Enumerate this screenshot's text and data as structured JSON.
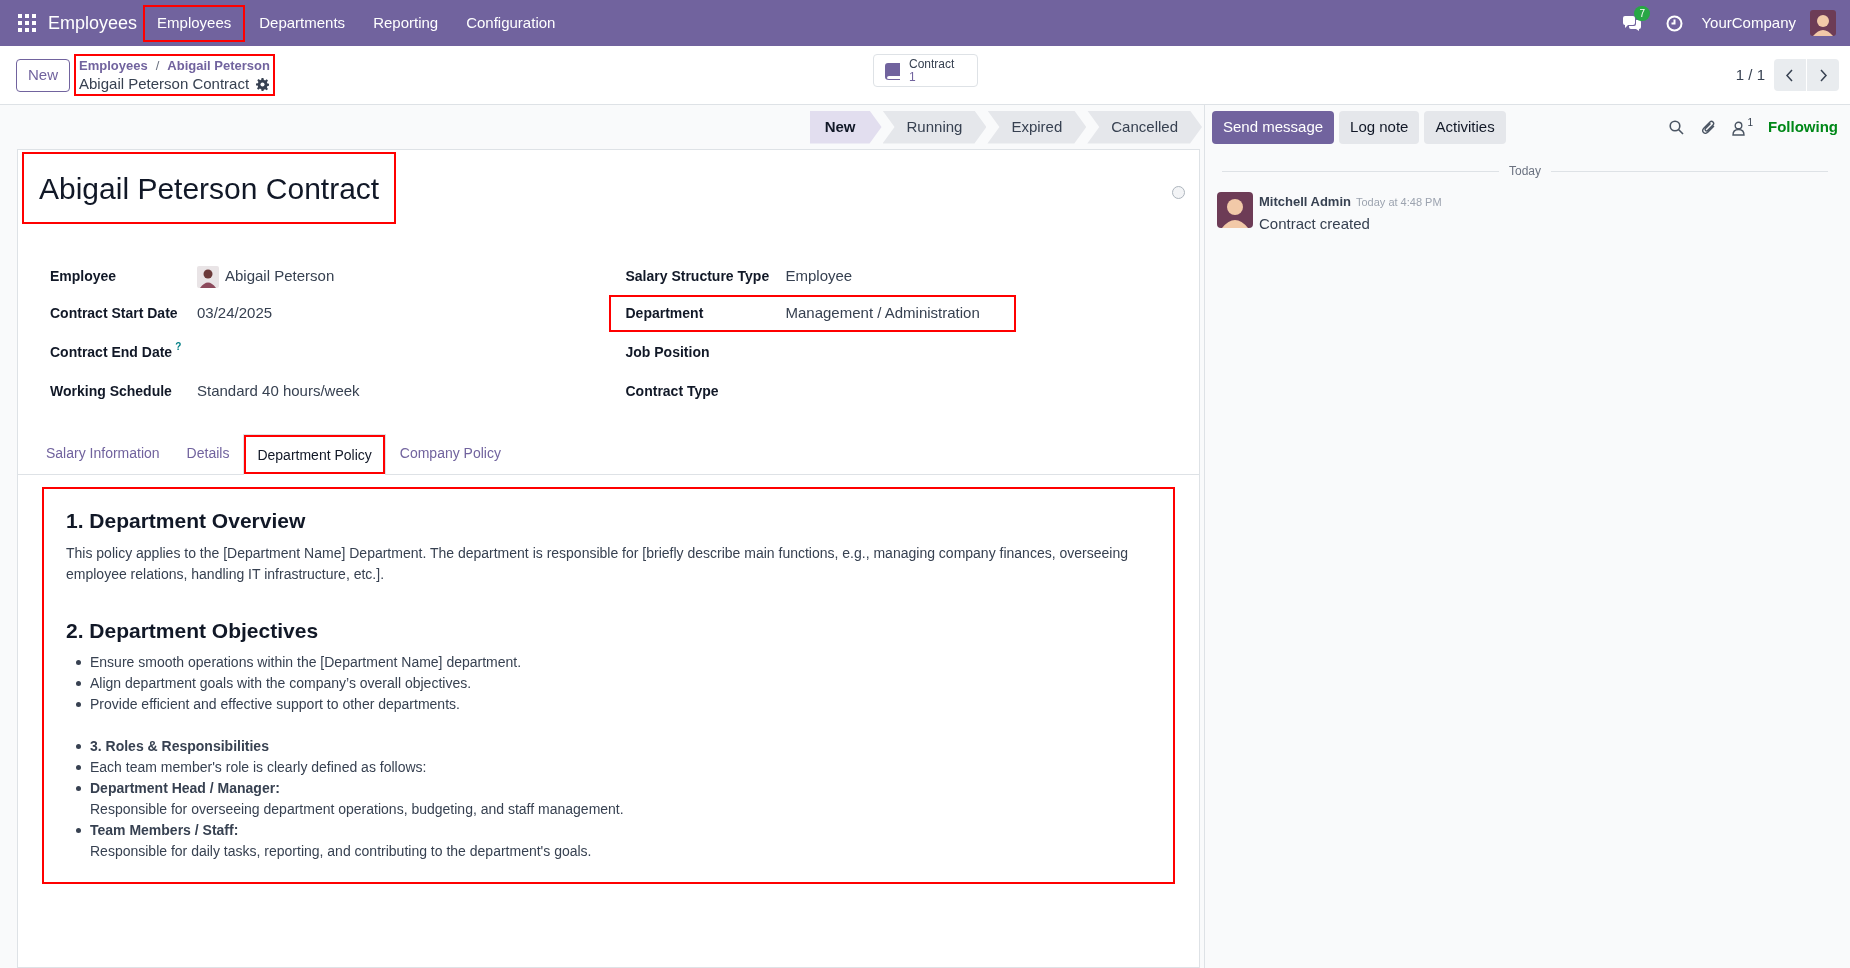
{
  "navbar": {
    "app_name": "Employees",
    "menu": [
      {
        "label": "Employees",
        "highlighted": true
      },
      {
        "label": "Departments",
        "highlighted": false
      },
      {
        "label": "Reporting",
        "highlighted": false
      },
      {
        "label": "Configuration",
        "highlighted": false
      }
    ],
    "messages_badge": "7",
    "company": "YourCompany"
  },
  "control_panel": {
    "new_button": "New",
    "breadcrumbs": [
      "Employees",
      "Abigail Peterson"
    ],
    "breadcrumb_separator": "/",
    "record_title": "Abigail Peterson Contract",
    "highlighted": true,
    "smart_button": {
      "label": "Contract",
      "count": "1"
    },
    "pager": "1 / 1"
  },
  "status_steps": [
    {
      "label": "New",
      "selected": true
    },
    {
      "label": "Running",
      "selected": false
    },
    {
      "label": "Expired",
      "selected": false
    },
    {
      "label": "Cancelled",
      "selected": false
    }
  ],
  "form": {
    "title": "Abigail Peterson Contract",
    "title_highlighted": true,
    "left_fields": [
      {
        "label": "Employee",
        "value": "Abigail Peterson",
        "kind": "avatar",
        "highlighted": false
      },
      {
        "label": "Contract Start Date",
        "value": "03/24/2025",
        "kind": "text",
        "highlighted": false
      },
      {
        "label": "Contract End Date",
        "help": "?",
        "highlighted": false
      },
      {
        "label": "Working Schedule",
        "value": "Standard 40 hours/week",
        "kind": "text",
        "highlighted": false
      }
    ],
    "right_fields": [
      {
        "label": "Salary Structure Type",
        "value": "Employee",
        "kind": "text",
        "highlighted": false
      },
      {
        "label": "Department",
        "value": "Management / Administration",
        "kind": "text",
        "highlighted": true
      },
      {
        "label": "Job Position",
        "highlighted": false
      },
      {
        "label": "Contract Type",
        "highlighted": false
      }
    ],
    "tabs": [
      {
        "label": "Salary Information",
        "selected": false,
        "highlighted": false
      },
      {
        "label": "Details",
        "selected": false,
        "highlighted": false
      },
      {
        "label": "Department Policy",
        "selected": true,
        "highlighted": true
      },
      {
        "label": "Company Policy",
        "selected": false,
        "highlighted": false
      }
    ],
    "policy": {
      "highlighted": true,
      "sections": [
        {
          "heading": "1. Department Overview",
          "paragraph": "This policy applies to the [Department Name] Department. The department is responsible for [briefly describe main functions, e.g., managing company finances, overseeing employee relations, handling IT infrastructure, etc.]."
        },
        {
          "heading": "2. Department Objectives",
          "lists": [
            [
              {
                "kind": "text",
                "text": "Ensure smooth operations within the [Department Name] department."
              },
              {
                "kind": "text",
                "text": "Align department goals with the company’s overall objectives."
              },
              {
                "kind": "text",
                "text": "Provide efficient and effective support to other departments."
              }
            ],
            [
              {
                "kind": "heading",
                "text": "3. Roles & Responsibilities"
              },
              {
                "kind": "text",
                "text": "Each team member's role is clearly defined as follows:"
              },
              {
                "kind": "entry",
                "term": "Department Head / Manager:",
                "text": "Responsible for overseeing department operations, budgeting, and staff management."
              },
              {
                "kind": "entry",
                "term": "Team Members / Staff:",
                "text": "Responsible for daily tasks, reporting, and contributing to the department's goals."
              }
            ]
          ]
        }
      ]
    }
  },
  "chatter": {
    "buttons": [
      {
        "label": "Send message",
        "primary": true
      },
      {
        "label": "Log note",
        "primary": false
      },
      {
        "label": "Activities",
        "primary": false
      }
    ],
    "followers_count": "1",
    "follow_label": "Following",
    "date_separator": "Today",
    "messages": [
      {
        "author": "Mitchell Admin",
        "time": "Today at 4:48 PM",
        "body": "Contract created"
      }
    ]
  }
}
